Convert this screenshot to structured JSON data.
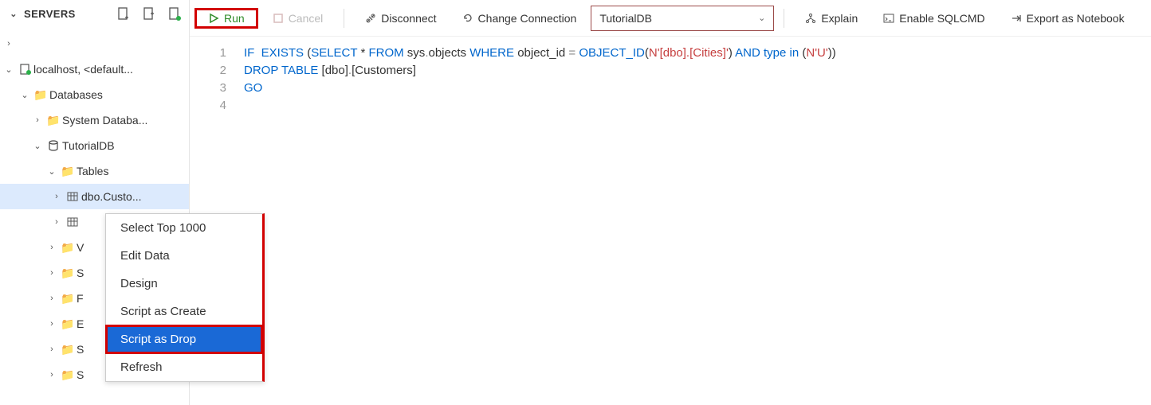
{
  "sidebar": {
    "title": "SERVERS",
    "nodes": {
      "blank": "",
      "connection": "localhost, <default...",
      "databases": "Databases",
      "sysdb": "System Databa...",
      "tutorialdb": "TutorialDB",
      "tables": "Tables",
      "custo": "dbo.Custo...",
      "trunc1": "V",
      "trunc2": "S",
      "trunc3": "F",
      "trunc4": "E",
      "trunc5": "S",
      "trunc6": "S"
    }
  },
  "toolbar": {
    "run": "Run",
    "cancel": "Cancel",
    "disconnect": "Disconnect",
    "change": "Change Connection",
    "dbselect": "TutorialDB",
    "explain": "Explain",
    "sqlcmd": "Enable SQLCMD",
    "notebook": "Export as Notebook"
  },
  "editor": {
    "ln1": "1",
    "ln2": "2",
    "ln3": "3",
    "ln4": "4",
    "l1_a": "IF  EXISTS ",
    "l1_b": "(",
    "l1_c": "SELECT",
    "l1_d": " * ",
    "l1_e": "FROM",
    "l1_f": " sys",
    "l1_g": ".",
    "l1_h": "objects ",
    "l1_i": "WHERE",
    "l1_j": " object_id ",
    "l1_k": "=",
    "l1_l": " OBJECT_ID",
    "l1_m": "(",
    "l1_n": "N'[dbo].[Cities]'",
    "l1_o": ")",
    "l1_p": " AND type in ",
    "l1_q": "(",
    "l1_r": "N'U'",
    "l1_s": "))",
    "l2_a": "DROP TABLE ",
    "l2_b": "[dbo]",
    "l2_c": ".",
    "l2_d": "[Customers]",
    "l3": "GO"
  },
  "context": {
    "select1000": "Select Top 1000",
    "editdata": "Edit Data",
    "design": "Design",
    "create": "Script as Create",
    "drop": "Script as Drop",
    "refresh": "Refresh"
  }
}
